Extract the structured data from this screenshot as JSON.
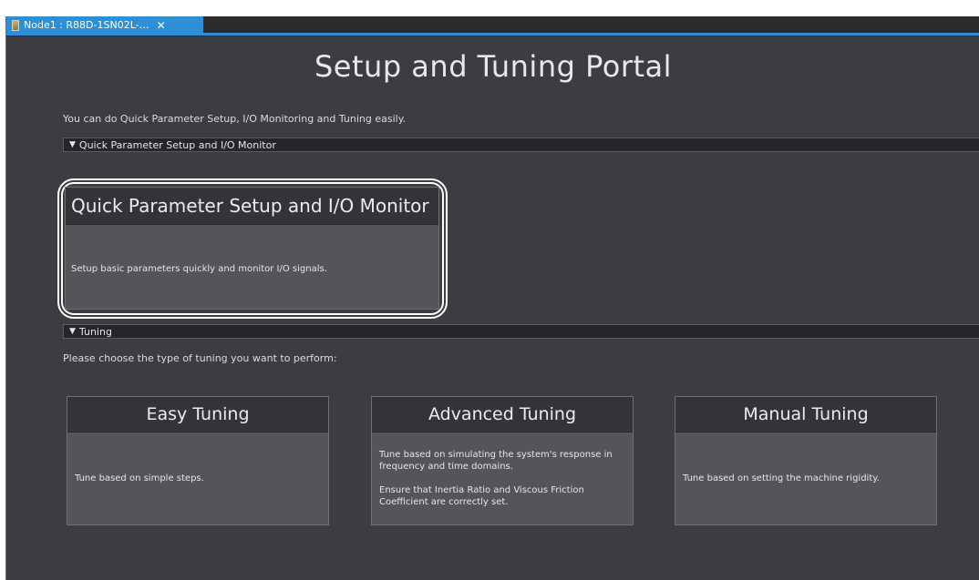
{
  "tab": {
    "label": "Node1 : R88D-1SN02L-…",
    "close": "✕"
  },
  "portal": {
    "title": "Setup and Tuning Portal",
    "intro": "You can do Quick Parameter Setup, I/O Monitoring and Tuning easily."
  },
  "quick_section": {
    "arrow": "▼",
    "label": "Quick Parameter Setup and I/O Monitor",
    "card": {
      "title": "Quick Parameter Setup and I/O Monitor",
      "description": "Setup basic parameters quickly and monitor I/O signals."
    }
  },
  "tuning_section": {
    "arrow": "▼",
    "label": "Tuning",
    "prompt": "Please choose the type of tuning you want to perform:",
    "cards": [
      {
        "title": "Easy Tuning",
        "description": "Tune based on simple steps."
      },
      {
        "title": "Advanced Tuning",
        "description": "Tune based on simulating the system's response in frequency and time domains.",
        "note": "Ensure that Inertia Ratio and Viscous Friction Coefficient are correctly set."
      },
      {
        "title": "Manual Tuning",
        "description": "Tune based on setting the machine rigidity."
      }
    ]
  },
  "colors": {
    "background": "#3c3d40",
    "tab_accent": "#2f8fd6",
    "card_header": "#333438",
    "card_body": "#545559",
    "highlight_outline": "#ffffff"
  }
}
